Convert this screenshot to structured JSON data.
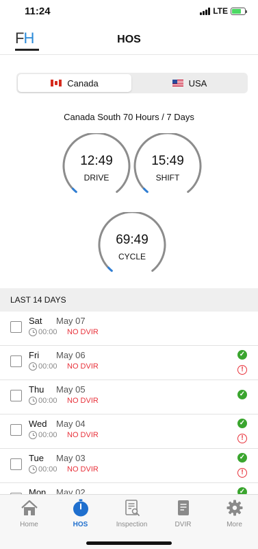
{
  "status_bar": {
    "time": "11:24",
    "network": "LTE"
  },
  "header": {
    "logo_text_f": "F",
    "logo_text_h": "H",
    "title": "HOS"
  },
  "region_tabs": [
    {
      "label": "Canada",
      "flag": "canada-flag-icon",
      "selected": true
    },
    {
      "label": "USA",
      "flag": "usa-flag-icon",
      "selected": false
    }
  ],
  "rule_text": "Canada South 70 Hours / 7 Days",
  "gauges": {
    "drive": {
      "time": "12:49",
      "label": "DRIVE"
    },
    "shift": {
      "time": "15:49",
      "label": "SHIFT"
    },
    "cycle": {
      "time": "69:49",
      "label": "CYCLE"
    }
  },
  "section_title": "LAST 14 DAYS",
  "days": [
    {
      "day": "Sat",
      "date": "May 07",
      "hours": "00:00",
      "dvir": "NO DVIR",
      "check": false,
      "warning": false
    },
    {
      "day": "Fri",
      "date": "May 06",
      "hours": "00:00",
      "dvir": "NO DVIR",
      "check": true,
      "warning": true
    },
    {
      "day": "Thu",
      "date": "May 05",
      "hours": "00:00",
      "dvir": "NO DVIR",
      "check": true,
      "warning": false
    },
    {
      "day": "Wed",
      "date": "May 04",
      "hours": "00:00",
      "dvir": "NO DVIR",
      "check": true,
      "warning": true
    },
    {
      "day": "Tue",
      "date": "May 03",
      "hours": "00:00",
      "dvir": "NO DVIR",
      "check": true,
      "warning": true
    },
    {
      "day": "Mon",
      "date": "May 02",
      "hours": "",
      "dvir": "",
      "check": true,
      "warning": false
    }
  ],
  "tab_bar": {
    "home": "Home",
    "hos": "HOS",
    "inspection": "Inspection",
    "dvir": "DVIR",
    "more": "More"
  },
  "colors": {
    "accent": "#1f6fce",
    "gauge_track": "#8c8c8c",
    "gauge_progress": "#2f7fd6",
    "ok_green": "#3aa52e",
    "alert_red": "#e8313a"
  }
}
